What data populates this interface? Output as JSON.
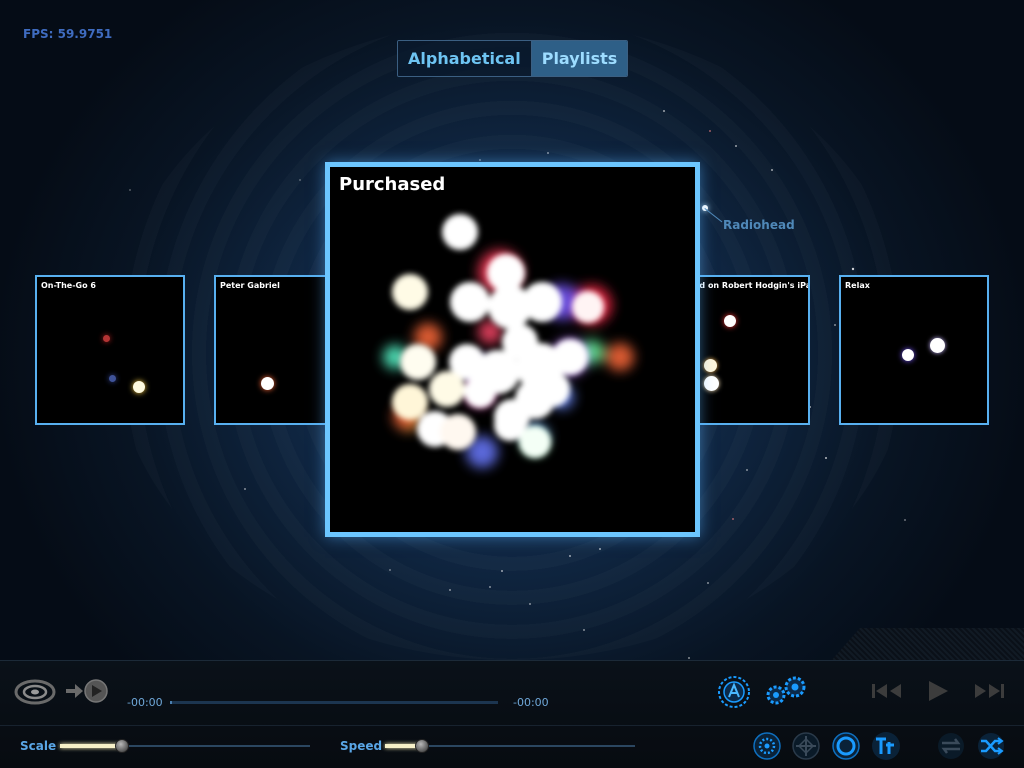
{
  "fps_label": "FPS: 59.9751",
  "view_tabs": [
    {
      "label": "Alphabetical",
      "active": false
    },
    {
      "label": "Playlists",
      "active": true
    }
  ],
  "playlists": {
    "focused": {
      "title": "Purchased"
    },
    "left_2": {
      "title": "On-The-Go 6"
    },
    "left_1": {
      "title": "Peter Gabriel"
    },
    "right_1": {
      "title": "ed on Robert Hodgin's iPad"
    },
    "right_2": {
      "title": "Relax"
    }
  },
  "floating_label": "Radiohead",
  "player": {
    "elapsed": "-00:00",
    "remaining": "-00:00",
    "progress": 0
  },
  "sliders": {
    "scale_label": "Scale",
    "scale_value": 0.24,
    "speed_label": "Speed",
    "speed_value": 0.15
  },
  "colors": {
    "accent": "#58b0f0",
    "icon_blue": "#1a9bff",
    "background": "#0f2540"
  },
  "icons": {
    "logo": "galaxy-logo-icon",
    "now_playing": "now-playing-icon",
    "alphabet": "alphabet-compass-icon",
    "settings": "gears-icon",
    "previous": "previous-track-icon",
    "play": "play-icon",
    "next": "next-track-icon",
    "gravity": "gravity-icon",
    "center": "center-view-icon",
    "orbit": "orbit-icon",
    "text": "text-toggle-icon",
    "repeat": "repeat-icon",
    "shuffle": "shuffle-icon"
  }
}
